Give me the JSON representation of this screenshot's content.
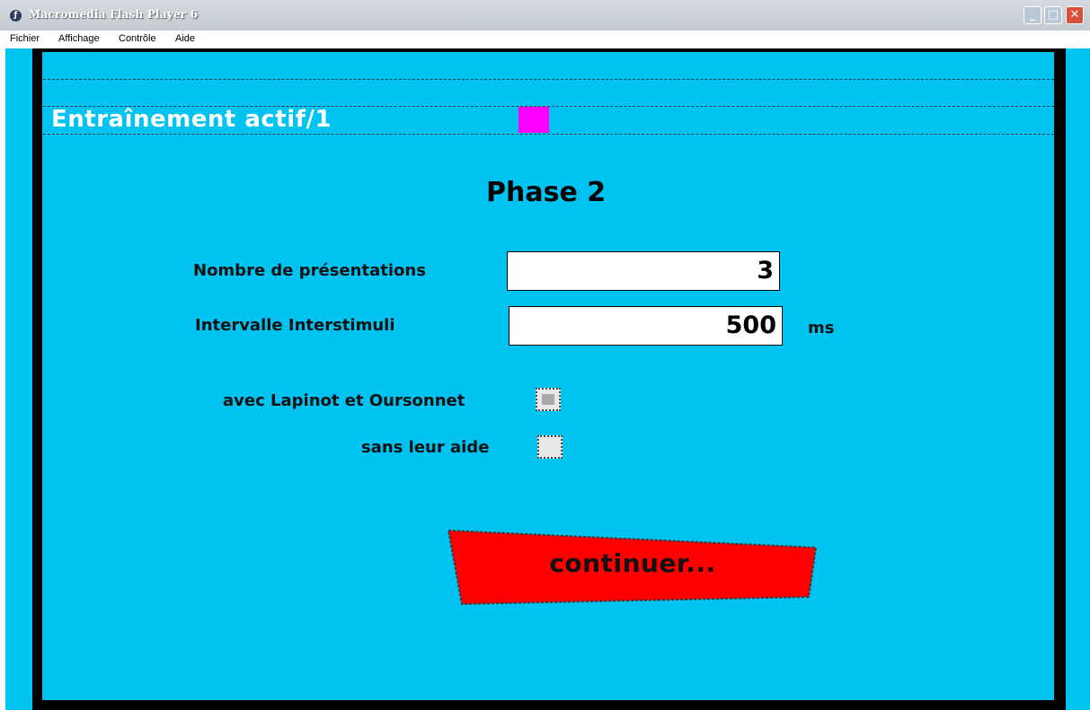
{
  "window": {
    "title": "Macromedia Flash Player 6",
    "app_icon": "flash-player-icon",
    "buttons": {
      "minimize": "_",
      "maximize": "□",
      "close": "✕"
    }
  },
  "menubar": {
    "items": [
      "Fichier",
      "Affichage",
      "Contrôle",
      "Aide"
    ]
  },
  "stage": {
    "background": "#00c3f2",
    "heading": "Entraînement actif/1",
    "marker_color": "#ff00ff",
    "phase_title": "Phase 2",
    "fields": {
      "presentations": {
        "label": "Nombre de présentations",
        "value": "3"
      },
      "interval": {
        "label": "Intervalle Interstimuli",
        "value": "500",
        "unit": "ms"
      }
    },
    "options": {
      "with_helpers": {
        "label": "avec Lapinot et Oursonnet",
        "checked": true
      },
      "without_help": {
        "label": "sans leur aide",
        "checked": false
      }
    },
    "continue_button": {
      "label": "continuer...",
      "color": "#ff0000"
    }
  }
}
